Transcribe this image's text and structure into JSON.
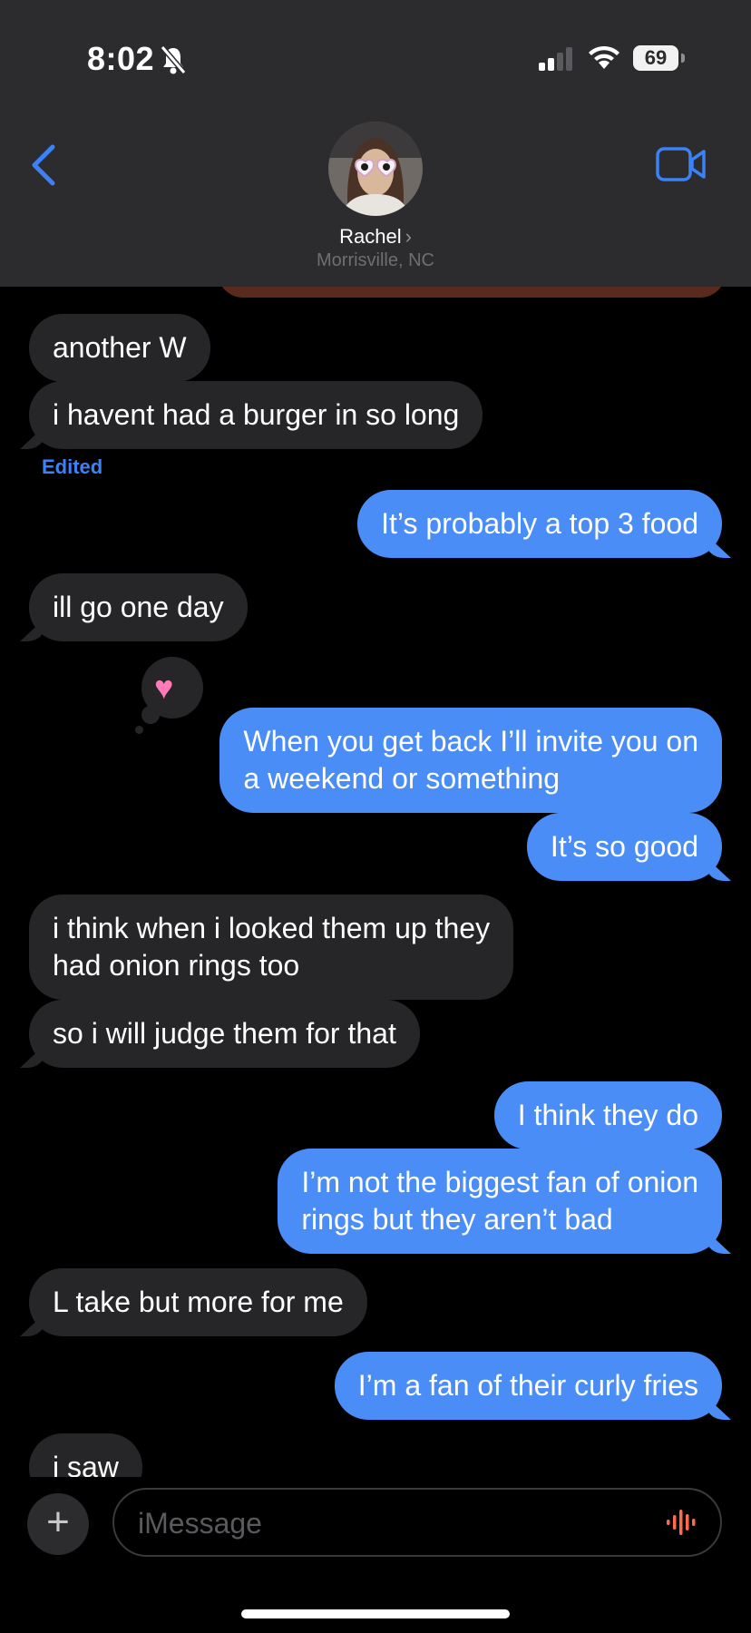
{
  "status": {
    "time": "8:02",
    "battery": "69"
  },
  "contact": {
    "name": "Rachel",
    "chevron": "›",
    "location": "Morrisville, NC"
  },
  "messages": [
    {
      "text": "another W"
    },
    {
      "text": "i havent had a burger in so long"
    },
    {
      "text": "Edited"
    },
    {
      "text": "It’s probably a top 3 food"
    },
    {
      "text": "ill go one day"
    },
    {
      "line1": "When you get back I’ll invite you on",
      "line2": "a weekend or something",
      "reaction": "heart"
    },
    {
      "text": "It’s so good"
    },
    {
      "line1": "i think when i looked them up they",
      "line2": "had onion rings too"
    },
    {
      "text": "so i will judge them for that"
    },
    {
      "text": "I think they do"
    },
    {
      "line1": "I’m not the biggest fan of onion",
      "line2": "rings but they aren’t bad"
    },
    {
      "text": "L take but more for me"
    },
    {
      "text": "I’m a fan of their curly fries"
    },
    {
      "text": "i saw"
    }
  ],
  "composer": {
    "plus": "+",
    "placeholder": "iMessage"
  },
  "colors": {
    "outgoing": "#4b8df6",
    "incoming": "#262628",
    "header": "#2c2c2e",
    "accent": "#3b82f6"
  }
}
